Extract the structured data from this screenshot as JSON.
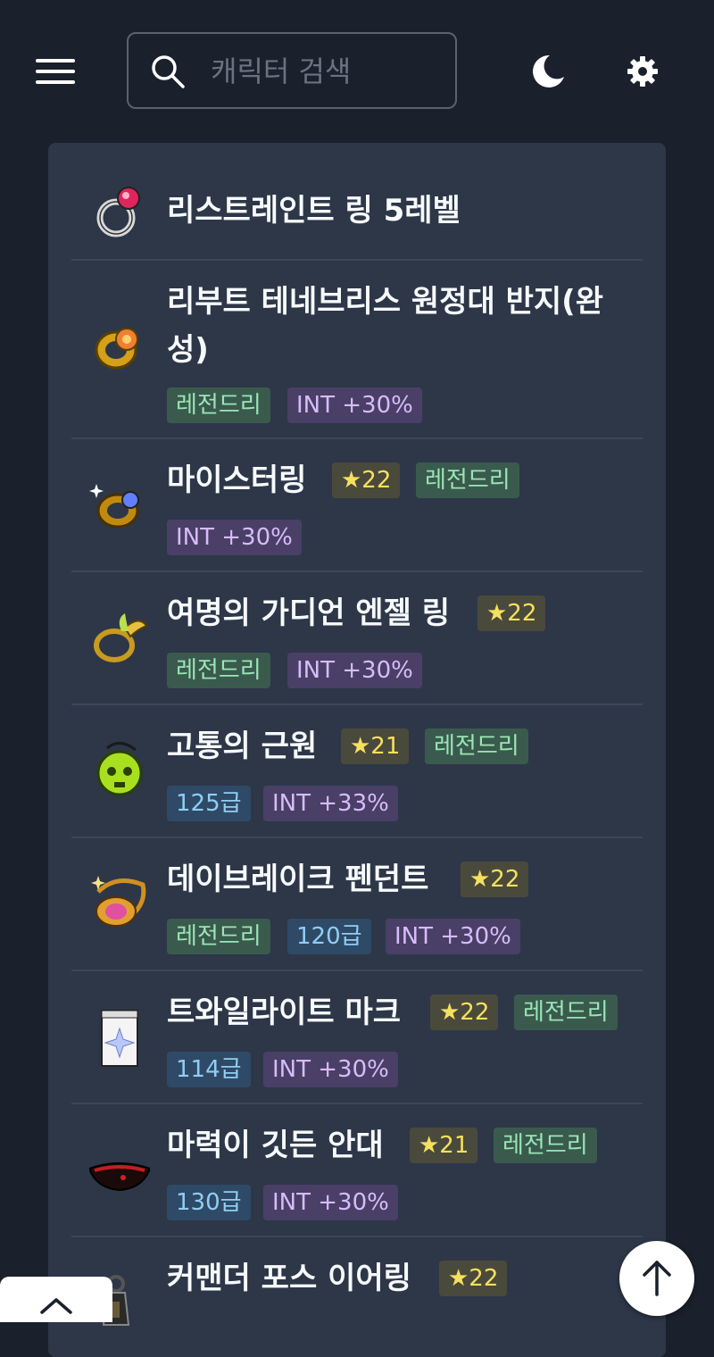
{
  "header": {
    "search": {
      "placeholder": "캐릭터 검색",
      "value": ""
    }
  },
  "items": [
    {
      "name": "리스트레인트 링 5레벨",
      "star": "",
      "tags": []
    },
    {
      "name_line1": "리부트 테네브리스 원정대 반지(완",
      "name_line2": "성)",
      "tags": [
        "레전드리",
        "INT +30%"
      ]
    },
    {
      "name": "마이스터링",
      "star": "★22",
      "tags": [
        "레전드리",
        "INT +30%"
      ]
    },
    {
      "name": "여명의 가디언 엔젤 링",
      "star": "★22",
      "tags": [
        "레전드리",
        "INT +30%"
      ]
    },
    {
      "name": "고통의 근원",
      "star": "★21",
      "tags": [
        "레전드리",
        "125급",
        "INT +33%"
      ]
    },
    {
      "name": "데이브레이크 펜던트",
      "star": "★22",
      "tags": [
        "레전드리",
        "120급",
        "INT +30%"
      ]
    },
    {
      "name": "트와일라이트 마크",
      "star": "★22",
      "tags": [
        "레전드리",
        "114급",
        "INT +30%"
      ]
    },
    {
      "name": "마력이 깃든 안대",
      "star": "★21",
      "tags": [
        "레전드리",
        "130급",
        "INT +30%"
      ]
    },
    {
      "name": "커맨더 포스 이어링",
      "star": "★22",
      "tags": []
    }
  ],
  "icons": {
    "menu": "hamburger-icon",
    "search": "search-icon",
    "theme": "moon-icon",
    "settings": "gear-icon",
    "scroll_top": "arrow-up-icon",
    "drawer": "chevron-up-icon"
  },
  "colors": {
    "background": "#1a202c",
    "card": "#2d3748",
    "legendary": "#9ae6b4",
    "star": "#f6e05e",
    "tier": "#90cdf4",
    "stat": "#d6bcfa"
  }
}
